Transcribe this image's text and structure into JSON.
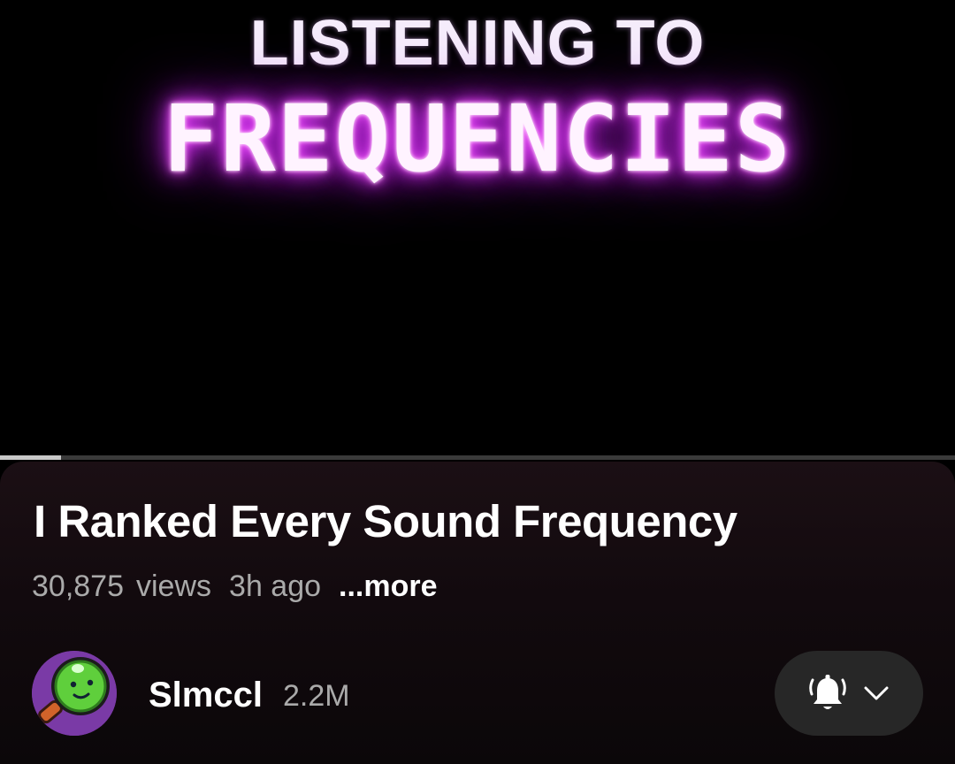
{
  "video": {
    "overlay_line1": "LISTENING TO",
    "overlay_line2": "FREQUENCIES",
    "progress_fraction": 0.064
  },
  "details": {
    "title": "I Ranked Every Sound Frequency",
    "view_count": "30,875",
    "views_label": "views",
    "age": "3h ago",
    "more_label": "...more"
  },
  "channel": {
    "name": "Slmccl",
    "subscribers": "2.2M",
    "avatar_icon": "green-blob-magnifier-avatar"
  },
  "subscribe": {
    "icons": [
      "bell-ringing-icon",
      "chevron-down-icon"
    ]
  },
  "colors": {
    "glow": "#e23cff",
    "panel_bg": "#1b0f14",
    "button_bg": "#272727",
    "secondary_text": "#aaaaaa"
  }
}
